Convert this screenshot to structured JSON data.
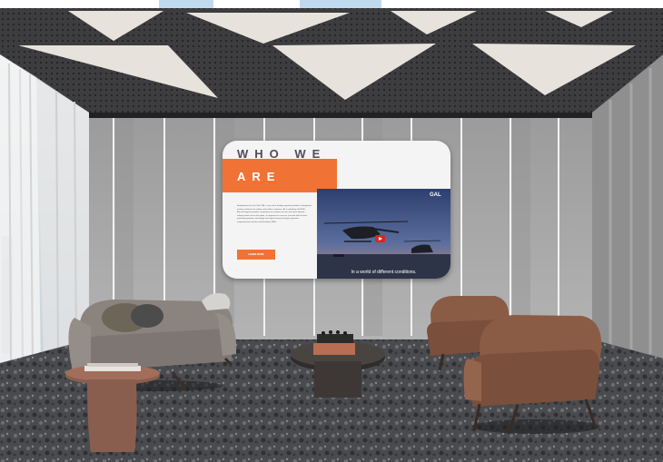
{
  "screen": {
    "heading_line1": "WHO WE",
    "heading_line2": "ARE",
    "body_text": "Headquartered in the Gulf, GAL is one of the leading regional providers of integrated aviation solutions for military and civilian customers. As a subsidiary of EDGE, Aircraft Support provides comprehensive aviation services that meet dynamic military needs across the globe. To augment our success, we work with the best performing partners and supply and support teams through systematic comprehensive with the world-leading OEMs.",
    "button_label": "LEARN MORE",
    "video": {
      "logo": "GAL",
      "caption": "In a world of different conditions."
    }
  },
  "colors": {
    "accent_orange": "#f07335",
    "play_red": "#e32222",
    "wall_grey": "#a9a9a9",
    "ceiling_dark": "#3c3c3f",
    "ceiling_light": "#e7e3dc",
    "sofa_grey": "#8a837e",
    "chair_brown": "#8a5c45"
  }
}
